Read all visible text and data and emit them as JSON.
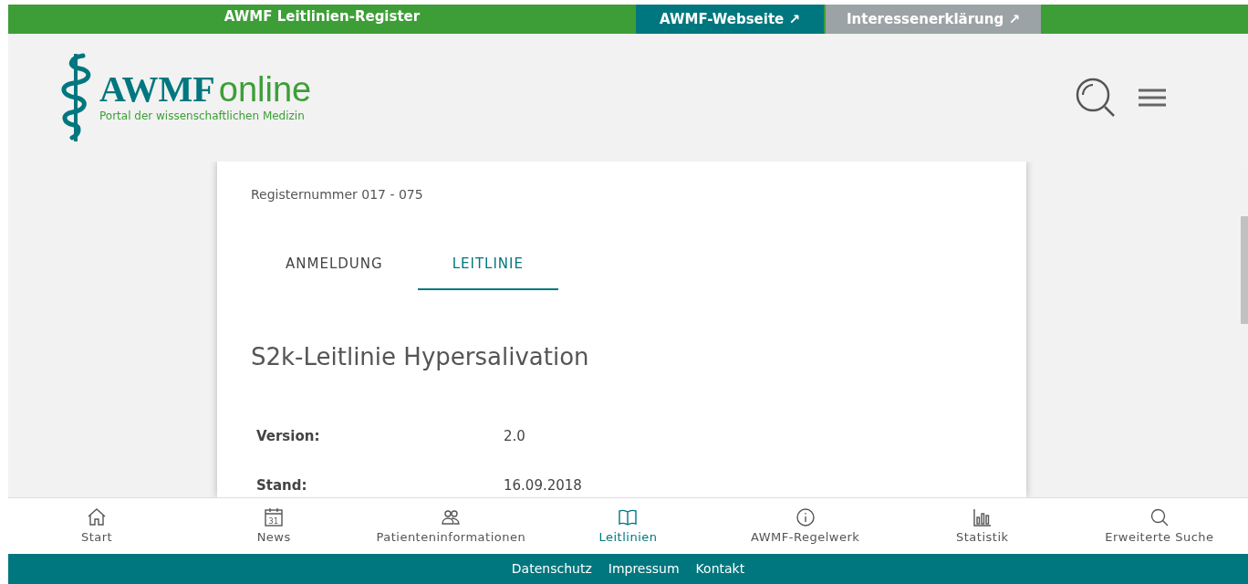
{
  "top_bar": {
    "title": "AWMF Leitlinien-Register",
    "links": [
      {
        "label": "AWMF-Webseite",
        "arrow": "↗",
        "color": "#00777f"
      },
      {
        "label": "Interessenerklärung",
        "arrow": "↗",
        "color": "#9ca3a6"
      }
    ]
  },
  "header": {
    "logo_title": "AWMF",
    "logo_title_suffix": "online",
    "logo_subtitle": "Portal der wissenschaftlichen Medizin"
  },
  "register_number": "Registernummer 017 - 075",
  "tabs": [
    {
      "label": "ANMELDUNG",
      "selected": false
    },
    {
      "label": "LEITLINIE",
      "selected": true
    }
  ],
  "guideline_title": "S2k-Leitlinie Hypersalivation",
  "fields": [
    {
      "label": "Version:",
      "value": "2.0"
    },
    {
      "label": "Stand:",
      "value": "16.09.2018"
    }
  ],
  "bottom_nav": [
    {
      "label": "Start",
      "selected": false
    },
    {
      "label": "News",
      "selected": false
    },
    {
      "label": "Patienteninformationen",
      "selected": false
    },
    {
      "label": "Leitlinien",
      "selected": true
    },
    {
      "label": "AWMF-Regelwerk",
      "selected": false
    },
    {
      "label": "Statistik",
      "selected": false
    },
    {
      "label": "Erweiterte Suche",
      "selected": false
    }
  ],
  "calendar_day": "31",
  "footer_links": [
    "Datenschutz",
    "Impressum",
    "Kontakt"
  ]
}
